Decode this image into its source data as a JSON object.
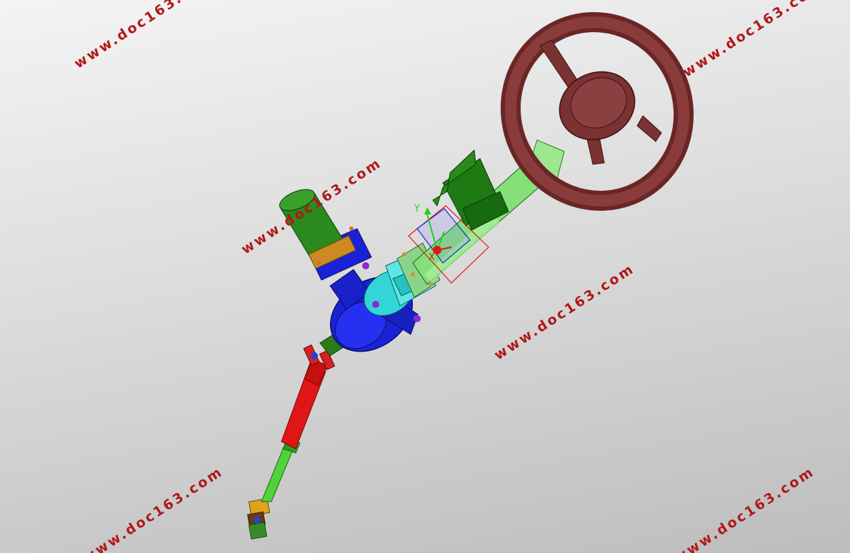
{
  "viewport": {
    "name": "3D model viewport",
    "background": {
      "top": "#f4f4f4",
      "bottom": "#bdbdbd"
    }
  },
  "watermarks": [
    "www.doc163.com",
    "www.doc163.com",
    "www.doc163.com",
    "www.doc163.com",
    "www.doc163.com",
    "www.doc163.com"
  ],
  "triad": {
    "y_label": "Y",
    "x_label": "X"
  },
  "colors": {
    "steering_wheel": "#7a3232",
    "column_green": "#86e07a",
    "bracket_dark_green": "#1f7a14",
    "motor_blue": "#1a22d8",
    "sensor_cyan": "#33d6d6",
    "shaft_red": "#e01616",
    "shaft_green": "#4fd23a",
    "joint_orange": "#e0a020",
    "triad_red": "#e01616",
    "triad_green": "#1fd21f",
    "watermark": "#b01818"
  }
}
